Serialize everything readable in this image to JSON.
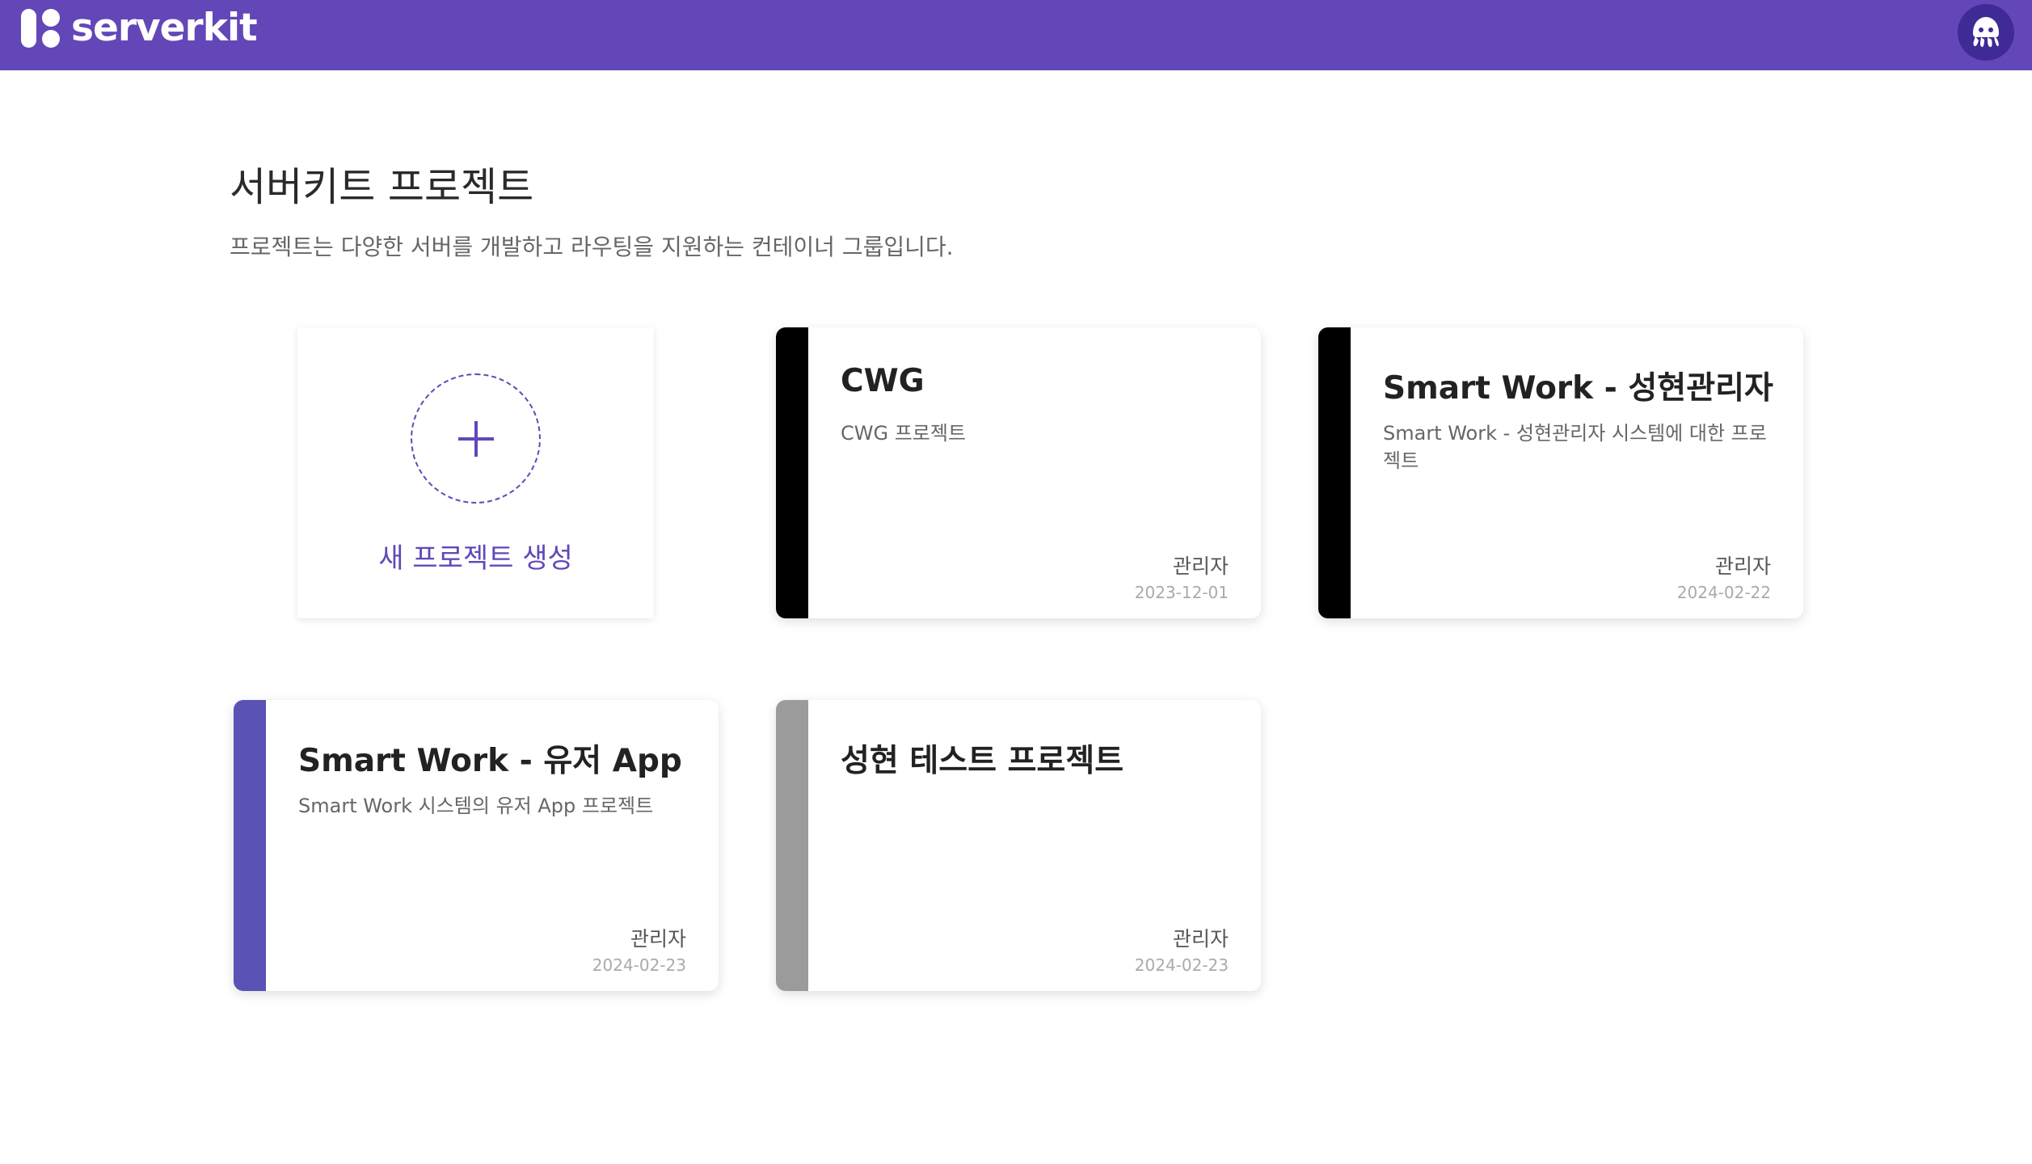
{
  "app": {
    "brand_name": "serverkit",
    "brand_color": "#6347b8"
  },
  "header": {
    "avatar_icon": "octopus-avatar-icon"
  },
  "page": {
    "title": "서버키트 프로젝트",
    "description": "프로젝트는 다양한 서버를 개발하고 라우팅을 지원하는 컨테이너 그룹입니다."
  },
  "new_project": {
    "label": "새 프로젝트 생성",
    "icon": "plus-icon"
  },
  "projects": [
    {
      "title": "CWG",
      "description": "CWG 프로젝트",
      "owner": "관리자",
      "date": "2023-12-01",
      "accent": "#000000"
    },
    {
      "title": "Smart Work - 성현관리자",
      "description": "Smart Work - 성현관리자 시스템에 대한 프로젝트",
      "owner": "관리자",
      "date": "2024-02-22",
      "accent": "#000000"
    },
    {
      "title": "Smart Work - 유저 App",
      "description": "Smart Work 시스템의 유저 App 프로젝트",
      "owner": "관리자",
      "date": "2024-02-23",
      "accent": "#5a52b5"
    },
    {
      "title": "성현 테스트 프로젝트",
      "description": "",
      "owner": "관리자",
      "date": "2024-02-23",
      "accent": "#9b9b9b"
    }
  ]
}
